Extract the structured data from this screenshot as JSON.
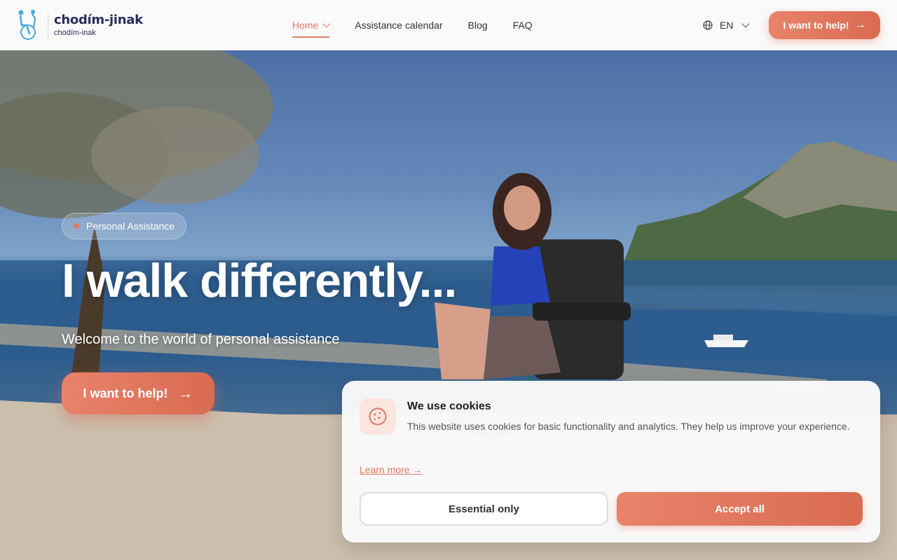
{
  "header": {
    "logo": {
      "name": "chodím-jinak",
      "subname": "chodím-inak"
    },
    "nav": [
      {
        "label": "Home",
        "active": true,
        "has_dropdown": true
      },
      {
        "label": "Assistance calendar",
        "active": false
      },
      {
        "label": "Blog",
        "active": false
      },
      {
        "label": "FAQ",
        "active": false
      }
    ],
    "language": {
      "label": "EN",
      "icon": "globe-icon"
    },
    "cta_label": "I want to help!",
    "cta_icon": "arrow-right-icon"
  },
  "hero": {
    "badge": "Personal Assistance",
    "title": "I walk differently...",
    "subtitle": "Welcome to the world of personal assistance",
    "cta_label": "I want to help!"
  },
  "cookie_banner": {
    "icon": "cookie-icon",
    "title": "We use cookies",
    "text": "This website uses cookies for basic functionality and analytics. They help us improve your experience.",
    "learn_more": "Learn more →",
    "essential_label": "Essential only",
    "accept_label": "Accept all"
  },
  "colors": {
    "accent": "#e07b5f",
    "brand_dark": "#2b2b5e",
    "logo_blue": "#4aa8d8"
  }
}
